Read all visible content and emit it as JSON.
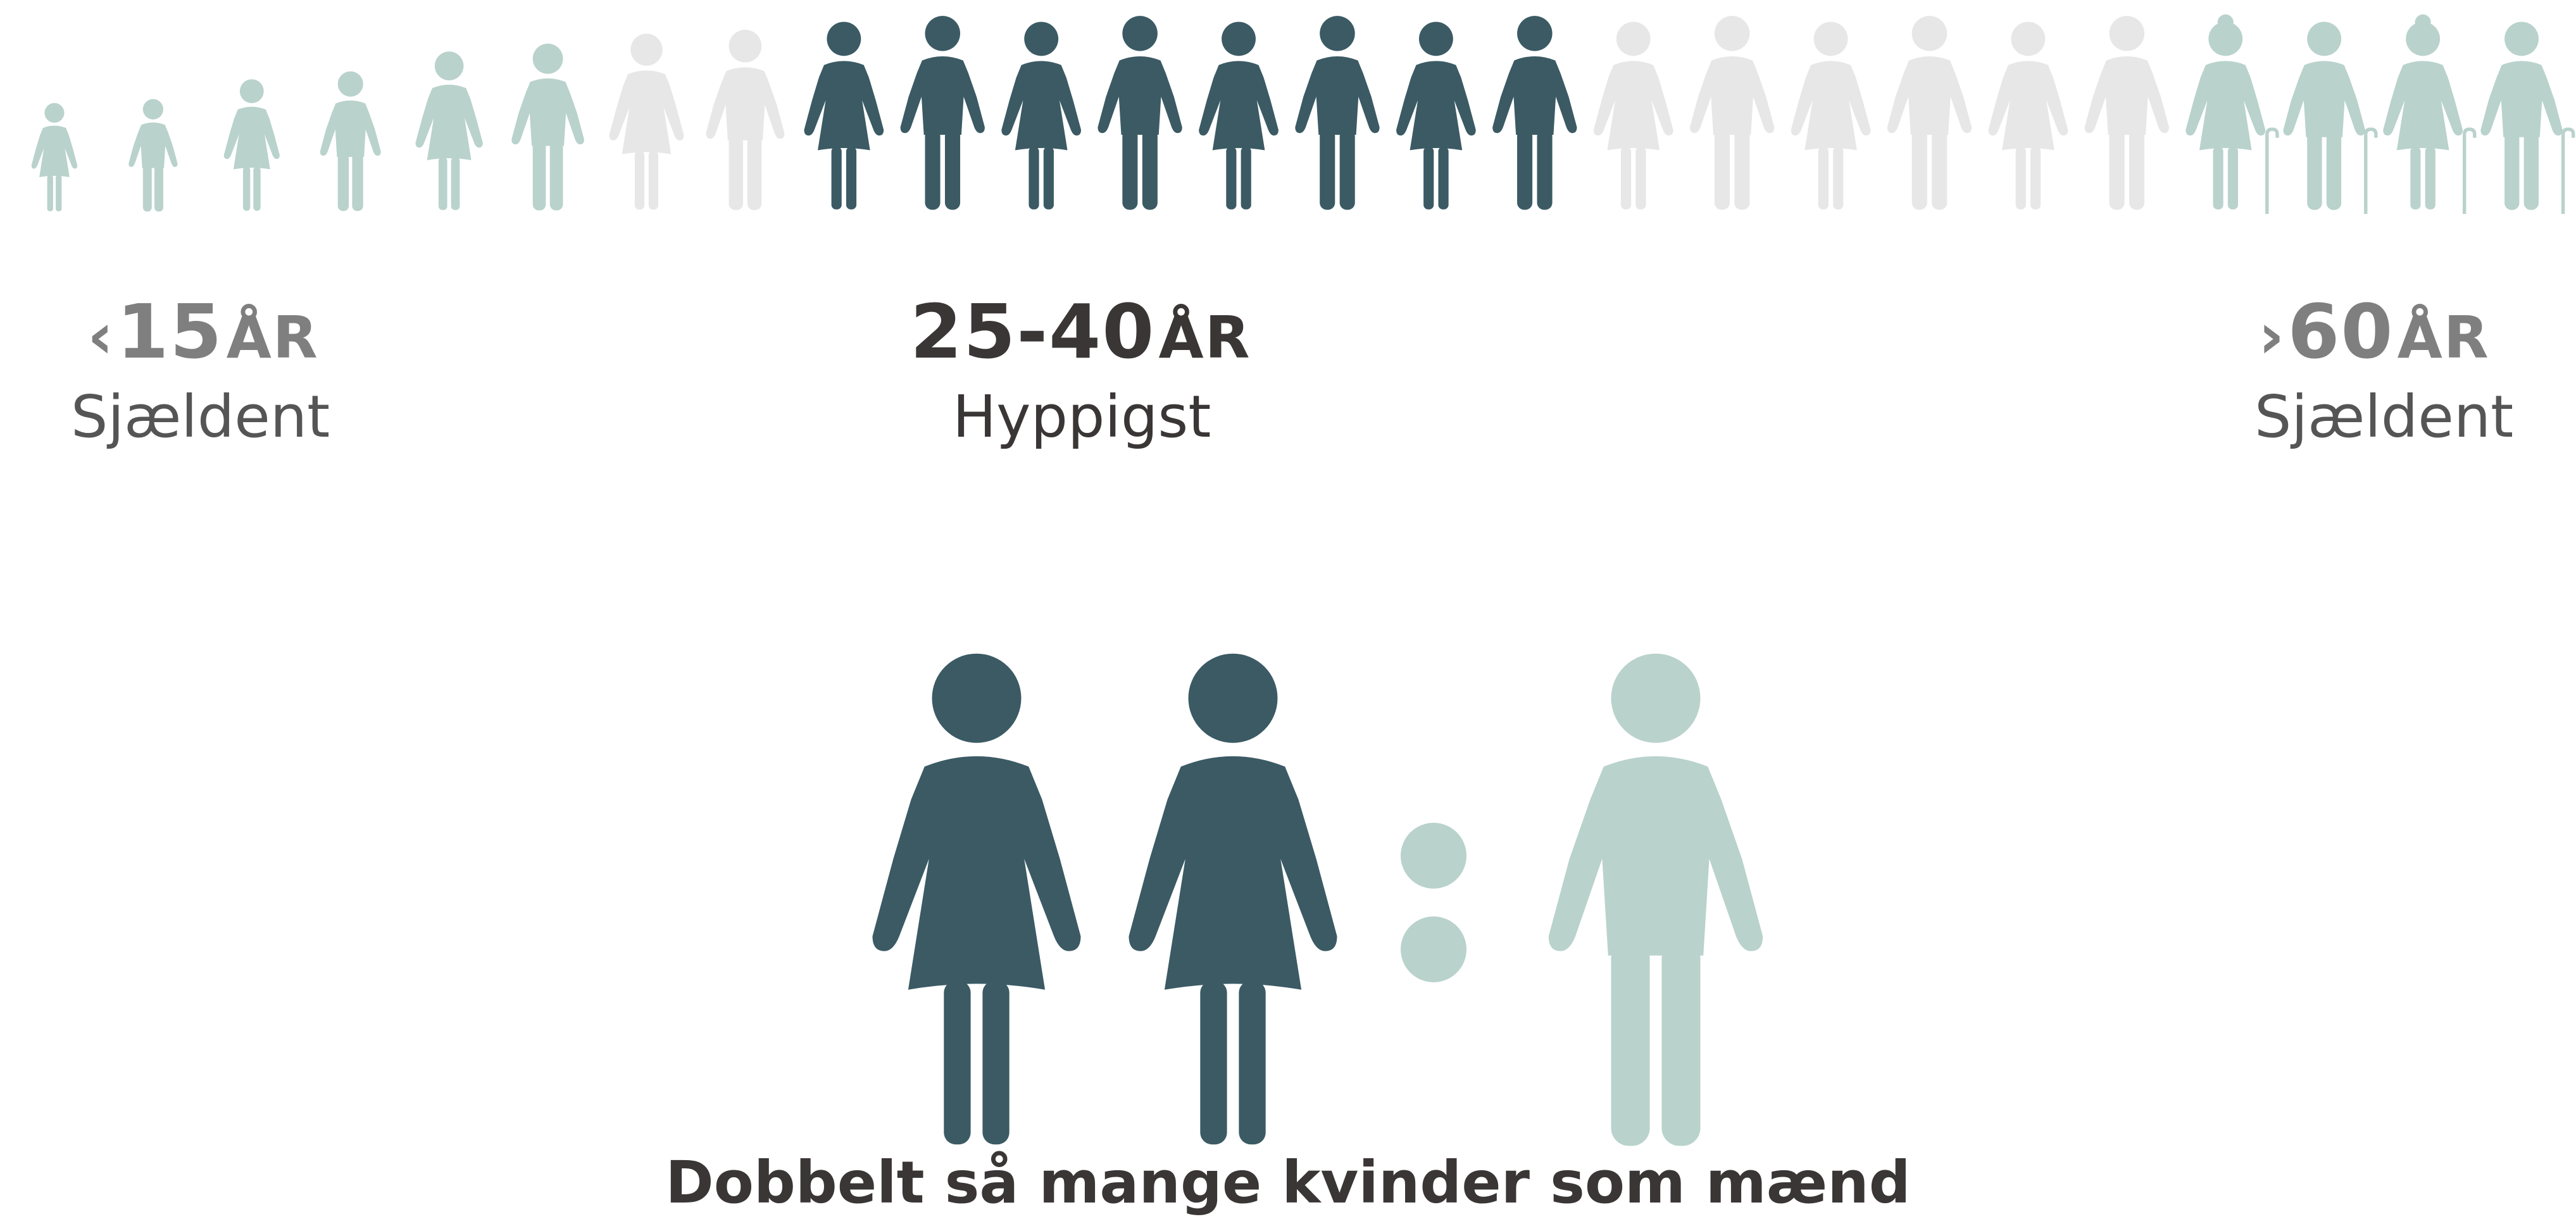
{
  "colors": {
    "dark": "#3b5a64",
    "sage": "#b9d2cc",
    "light": "#e7e7e7",
    "text_dark": "#3a3636",
    "text_grey": "#7f7f7f"
  },
  "age_row": [
    {
      "type": "female",
      "color": "sage",
      "scale": 0.56
    },
    {
      "type": "male",
      "color": "sage",
      "scale": 0.58
    },
    {
      "type": "female",
      "color": "sage",
      "scale": 0.68
    },
    {
      "type": "male",
      "color": "sage",
      "scale": 0.72
    },
    {
      "type": "female",
      "color": "sage",
      "scale": 0.82
    },
    {
      "type": "male",
      "color": "sage",
      "scale": 0.86
    },
    {
      "type": "female",
      "color": "light",
      "scale": 0.91
    },
    {
      "type": "male",
      "color": "light",
      "scale": 0.93
    },
    {
      "type": "female",
      "color": "dark",
      "scale": 0.97
    },
    {
      "type": "male",
      "color": "dark",
      "scale": 1.0
    },
    {
      "type": "female",
      "color": "dark",
      "scale": 0.97
    },
    {
      "type": "male",
      "color": "dark",
      "scale": 1.0
    },
    {
      "type": "female",
      "color": "dark",
      "scale": 0.97
    },
    {
      "type": "male",
      "color": "dark",
      "scale": 1.0
    },
    {
      "type": "female",
      "color": "dark",
      "scale": 0.97
    },
    {
      "type": "male",
      "color": "dark",
      "scale": 1.0
    },
    {
      "type": "female",
      "color": "light",
      "scale": 0.97
    },
    {
      "type": "male",
      "color": "light",
      "scale": 1.0
    },
    {
      "type": "female",
      "color": "light",
      "scale": 0.97
    },
    {
      "type": "male",
      "color": "light",
      "scale": 1.0
    },
    {
      "type": "female",
      "color": "light",
      "scale": 0.97
    },
    {
      "type": "male",
      "color": "light",
      "scale": 1.0
    },
    {
      "type": "female_elder",
      "color": "sage",
      "scale": 0.97
    },
    {
      "type": "male_elder",
      "color": "sage",
      "scale": 0.97
    },
    {
      "type": "female_elder",
      "color": "sage",
      "scale": 0.97
    },
    {
      "type": "male_elder",
      "color": "sage",
      "scale": 0.97
    }
  ],
  "labels": {
    "left_chevron": "‹",
    "left_age": "15",
    "left_unit": "ÅR",
    "left_sub": "Sjældent",
    "mid_age": "25-40",
    "mid_unit": "ÅR",
    "mid_sub": "Hyppigst",
    "right_chevron": "›",
    "right_age": "60",
    "right_unit": "ÅR",
    "right_sub": "Sjældent"
  },
  "ratio": {
    "left": [
      {
        "type": "female",
        "color": "dark"
      },
      {
        "type": "female",
        "color": "dark"
      }
    ],
    "right": [
      {
        "type": "male",
        "color": "sage"
      }
    ]
  },
  "caption": "Dobbelt så mange kvinder som mænd"
}
